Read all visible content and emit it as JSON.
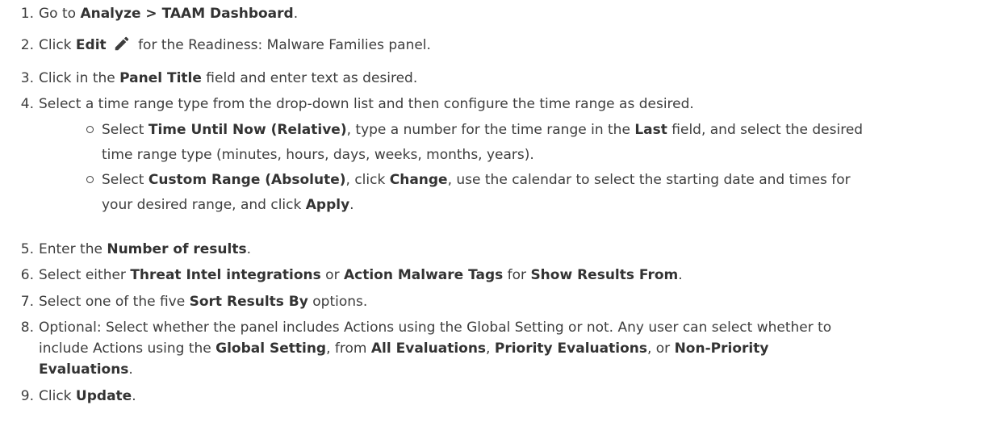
{
  "steps": [
    {
      "num": "1.",
      "parts": [
        {
          "t": "Go to "
        },
        {
          "t": "Analyze > TAAM Dashboard",
          "b": true
        },
        {
          "t": "."
        }
      ]
    },
    {
      "num": "2.",
      "parts": [
        {
          "t": "Click "
        },
        {
          "t": "Edit",
          "b": true
        },
        {
          "icon": "pencil-icon"
        },
        {
          "t": " for the Readiness: Malware Families panel."
        }
      ]
    },
    {
      "num": "3.",
      "parts": [
        {
          "t": "Click in the "
        },
        {
          "t": "Panel Title",
          "b": true
        },
        {
          "t": " field and enter text as desired."
        }
      ]
    },
    {
      "num": "4.",
      "parts": [
        {
          "t": "Select a time range type from the drop-down list and then configure the time range as desired."
        }
      ]
    },
    {
      "num": "5.",
      "parts": [
        {
          "t": "Enter the "
        },
        {
          "t": "Number of results",
          "b": true
        },
        {
          "t": "."
        }
      ]
    },
    {
      "num": "6.",
      "parts": [
        {
          "t": "Select either "
        },
        {
          "t": "Threat Intel integrations",
          "b": true
        },
        {
          "t": " or "
        },
        {
          "t": "Action Malware Tags",
          "b": true
        },
        {
          "t": " for "
        },
        {
          "t": "Show Results From",
          "b": true
        },
        {
          "t": "."
        }
      ]
    },
    {
      "num": "7.",
      "parts": [
        {
          "t": "Select one of the five "
        },
        {
          "t": "Sort Results By",
          "b": true
        },
        {
          "t": " options."
        }
      ]
    },
    {
      "num": "8.",
      "parts": [
        {
          "t": "Optional: Select whether the panel includes Actions using the Global Setting or not. Any user can select whether to"
        }
      ]
    },
    {
      "num": "9.",
      "parts": [
        {
          "t": "Click "
        },
        {
          "t": "Update",
          "b": true
        },
        {
          "t": "."
        }
      ]
    }
  ],
  "step8_cont": [
    [
      {
        "t": "include Actions using the "
      },
      {
        "t": "Global Setting",
        "b": true
      },
      {
        "t": ", from "
      },
      {
        "t": "All Evaluations",
        "b": true
      },
      {
        "t": ", "
      },
      {
        "t": "Priority Evaluations",
        "b": true
      },
      {
        "t": ", or "
      },
      {
        "t": "Non-Priority",
        "b": true
      }
    ],
    [
      {
        "t": "Evaluations",
        "b": true
      },
      {
        "t": "."
      }
    ]
  ],
  "substeps": [
    {
      "lines": [
        [
          {
            "t": "Select "
          },
          {
            "t": "Time Until Now (Relative)",
            "b": true
          },
          {
            "t": ", type a number for the time range in the "
          },
          {
            "t": "Last",
            "b": true
          },
          {
            "t": " field, and select the desired"
          }
        ],
        [
          {
            "t": "time range type (minutes, hours, days, weeks, months, years)."
          }
        ]
      ]
    },
    {
      "lines": [
        [
          {
            "t": "Select "
          },
          {
            "t": "Custom Range (Absolute)",
            "b": true
          },
          {
            "t": ", click "
          },
          {
            "t": "Change",
            "b": true
          },
          {
            "t": ", use the calendar to select the starting date and times for"
          }
        ],
        [
          {
            "t": "your desired range, and click "
          },
          {
            "t": "Apply",
            "b": true
          },
          {
            "t": "."
          }
        ]
      ]
    }
  ]
}
